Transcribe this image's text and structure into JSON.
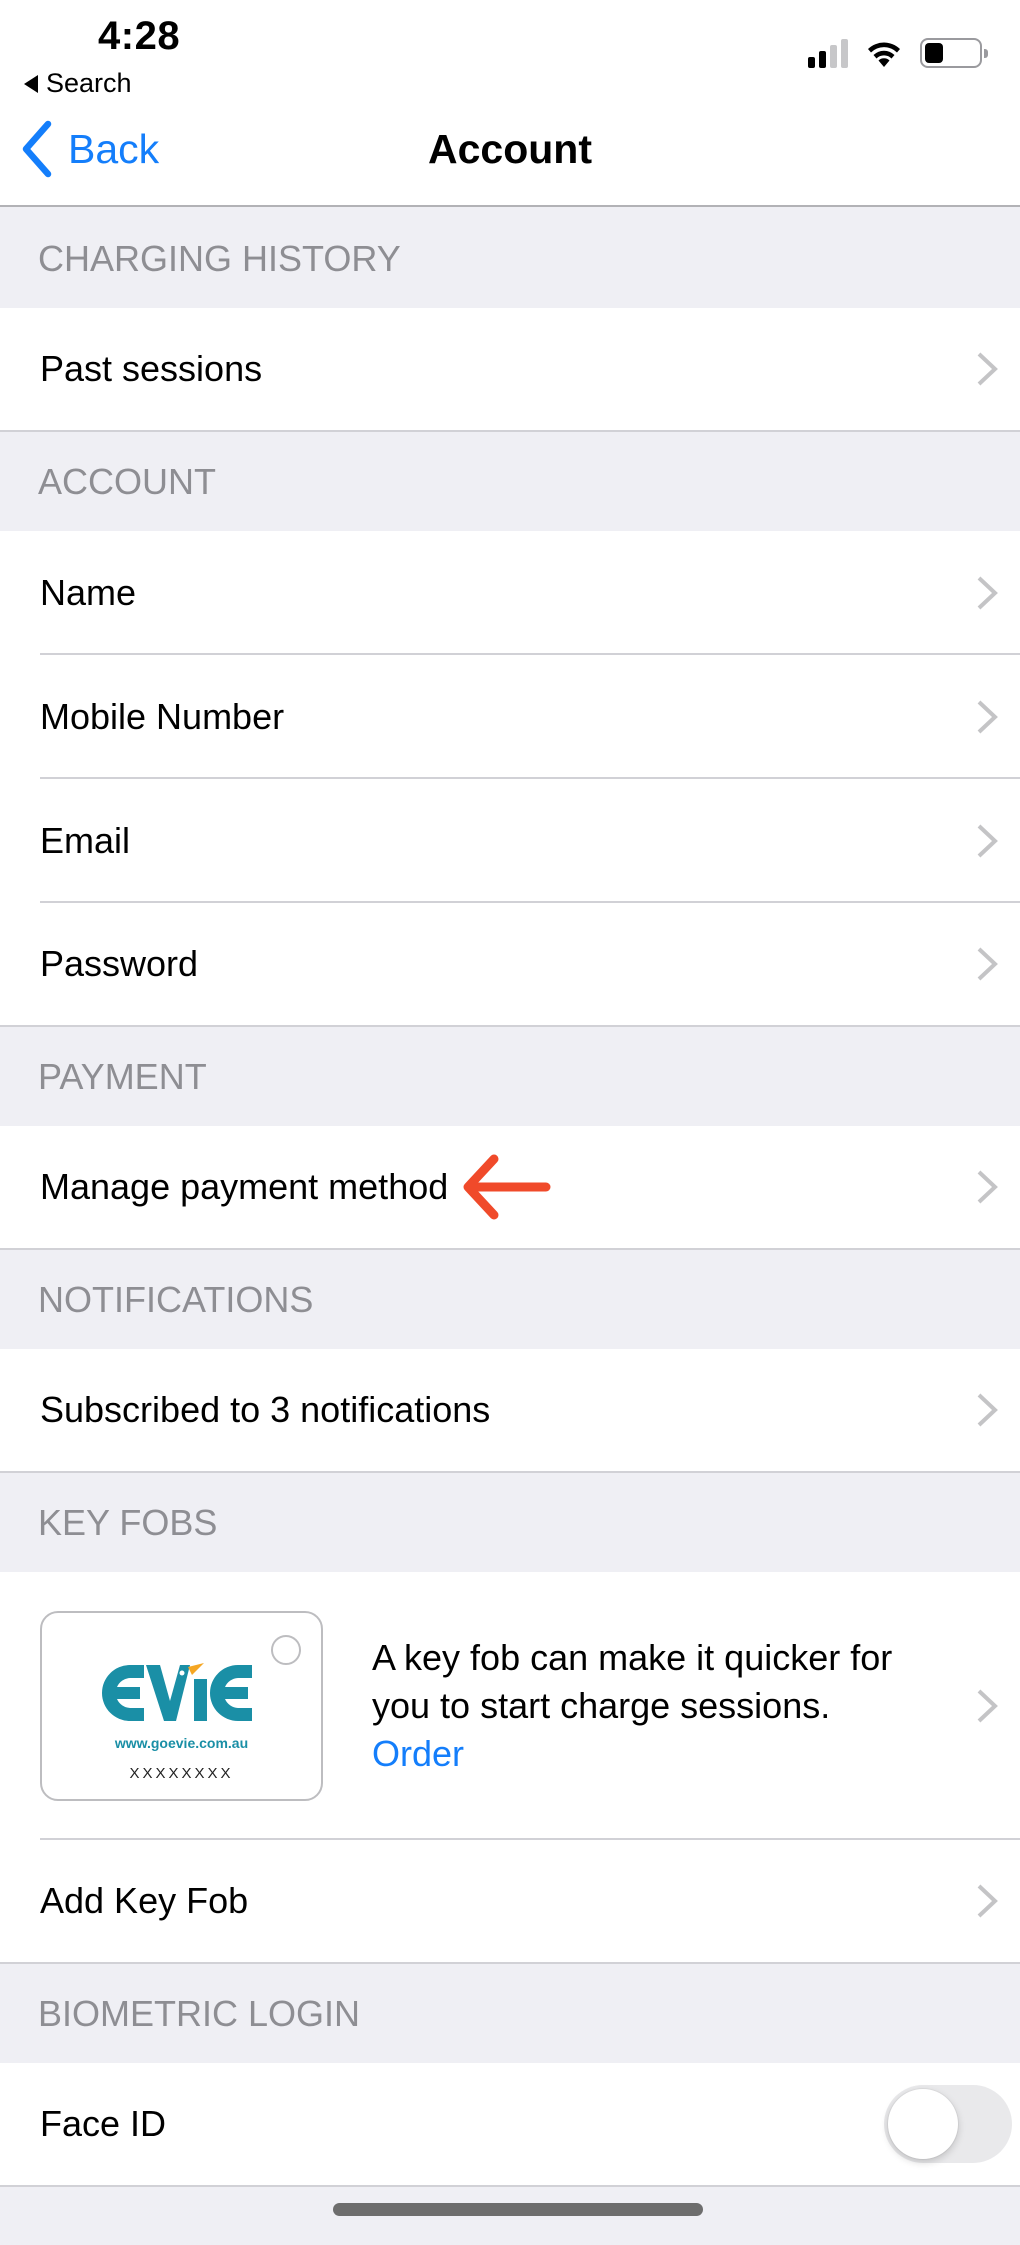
{
  "status_bar": {
    "time": "4:28",
    "breadcrumb": "Search",
    "signal_bars_active": 2,
    "signal_bars_total": 4,
    "battery_level": 0.35,
    "icons": [
      "cellular-signal-icon",
      "wifi-icon",
      "battery-icon"
    ]
  },
  "nav": {
    "back_label": "Back",
    "title": "Account"
  },
  "colors": {
    "accent": "#147efb",
    "annotation_arrow": "#f04a2a",
    "section_header_text": "#8e8e93",
    "background": "#efeff4",
    "chevron": "#c4c4c6",
    "evie_teal": "#1a8fa6",
    "evie_orange": "#f5a623"
  },
  "sections": {
    "charging_history": {
      "header": "CHARGING HISTORY",
      "rows": [
        {
          "label": "Past sessions"
        }
      ]
    },
    "account": {
      "header": "ACCOUNT",
      "rows": [
        {
          "label": "Name",
          "value": ""
        },
        {
          "label": "Mobile Number",
          "value": ""
        },
        {
          "label": "Email",
          "value": ""
        },
        {
          "label": "Password",
          "value": ""
        }
      ]
    },
    "payment": {
      "header": "PAYMENT",
      "rows": [
        {
          "label": "Manage payment method",
          "annotation": "red-arrow-pointing-left"
        }
      ]
    },
    "notifications": {
      "header": "NOTIFICATIONS",
      "rows": [
        {
          "label": "Subscribed to 3 notifications"
        }
      ]
    },
    "key_fobs": {
      "header": "KEY FOBS",
      "promo": {
        "card_brand": "EVIE",
        "card_url": "www.goevie.com.au",
        "card_serial": "XXXXXXXX",
        "description": "A key fob can make it quicker for you to start charge sessions.",
        "order_link": "Order"
      },
      "rows": [
        {
          "label": "Add Key Fob"
        }
      ]
    },
    "biometric_login": {
      "header": "BIOMETRIC LOGIN",
      "rows": [
        {
          "label": "Face ID",
          "toggle_on": false
        }
      ]
    }
  }
}
